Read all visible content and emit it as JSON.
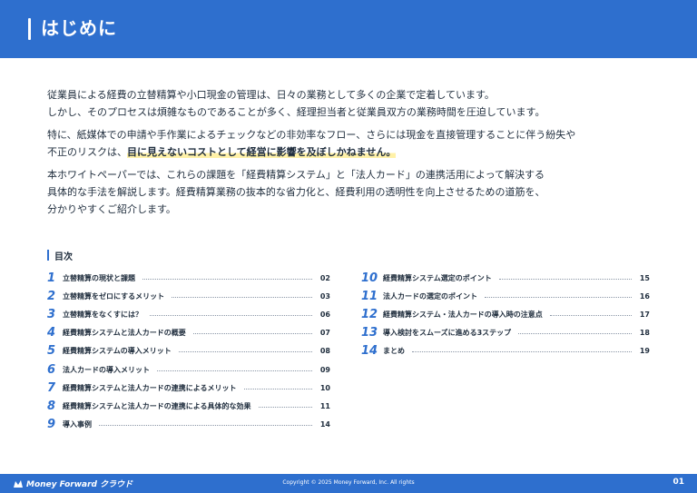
{
  "header": {
    "title": "はじめに"
  },
  "intro": {
    "p1": [
      "従業員による経費の立替精算や小口現金の管理は、日々の業務として多くの企業で定着しています。",
      "しかし、そのプロセスは煩雑なものであることが多く、経理担当者と従業員双方の業務時間を圧迫しています。"
    ],
    "p2_line1": "特に、紙媒体での申請や手作業によるチェックなどの非効率なフロー、さらには現金を直接管理することに伴う紛失や",
    "p2_line2_prefix": "不正のリスクは、",
    "p2_line2_highlight": "目に見えないコストとして経営に影響を及ぼしかねません。",
    "p3": [
      "本ホワイトペーパーでは、これらの課題を「経費精算システム」と「法人カード」の連携活用によって解決する",
      "具体的な手法を解説します。経費精算業務の抜本的な省力化と、経費利用の透明性を向上させるための道筋を、",
      "分かりやすくご紹介します。"
    ]
  },
  "toc": {
    "heading": "目次",
    "left": [
      {
        "num": "1",
        "label": "立替精算の現状と課題",
        "page": "02"
      },
      {
        "num": "2",
        "label": "立替精算をゼロにするメリット",
        "page": "03"
      },
      {
        "num": "3",
        "label": "立替精算をなくすには？",
        "page": "06"
      },
      {
        "num": "4",
        "label": "経費精算システムと法人カードの概要",
        "page": "07"
      },
      {
        "num": "5",
        "label": "経費精算システムの導入メリット",
        "page": "08"
      },
      {
        "num": "6",
        "label": "法人カードの導入メリット",
        "page": "09"
      },
      {
        "num": "7",
        "label": "経費精算システムと法人カードの連携によるメリット",
        "page": "10"
      },
      {
        "num": "8",
        "label": "経費精算システムと法人カードの連携による具体的な効果",
        "page": "11"
      },
      {
        "num": "9",
        "label": "導入事例",
        "page": "14"
      }
    ],
    "right": [
      {
        "num": "10",
        "label": "経費精算システム選定のポイント",
        "page": "15"
      },
      {
        "num": "11",
        "label": "法人カードの選定のポイント",
        "page": "16"
      },
      {
        "num": "12",
        "label": "経費精算システム・法人カードの導入時の注意点",
        "page": "17"
      },
      {
        "num": "13",
        "label": "導入検討をスムーズに進める3ステップ",
        "page": "18"
      },
      {
        "num": "14",
        "label": "まとめ",
        "page": "19"
      }
    ]
  },
  "footer": {
    "brand": "Money Forward クラウド",
    "copyright": "Copyright © 2025 Money Forward, Inc. All rights",
    "page_number": "01"
  },
  "colors": {
    "accent": "#2e6fce",
    "highlight": "#fff1a8",
    "text": "#1f2d3d"
  }
}
